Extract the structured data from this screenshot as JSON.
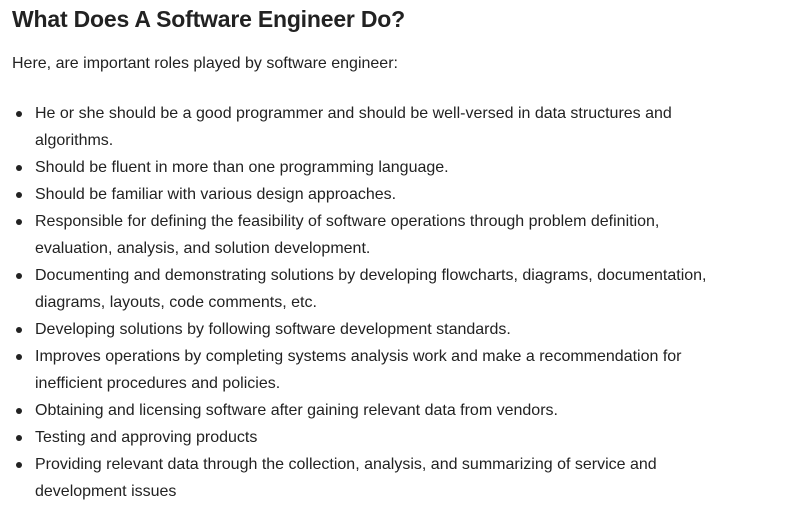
{
  "article": {
    "title": "What Does A Software Engineer Do?",
    "intro": "Here, are important roles played by software engineer:",
    "roles": [
      "He or she should be a good programmer and should be well-versed in data structures and algorithms.",
      "Should be fluent in more than one programming language.",
      "Should be familiar with various design approaches.",
      "Responsible for defining the feasibility of software operations through problem definition, evaluation, analysis, and solution development.",
      "Documenting and demonstrating solutions by developing flowcharts, diagrams, documentation, diagrams, layouts, code comments, etc.",
      "Developing solutions by following software development standards.",
      "Improves operations by completing systems analysis work and make a recommendation for inefficient procedures and policies.",
      "Obtaining and licensing software after gaining relevant data from vendors.",
      "Testing and approving products",
      "Providing relevant data through the collection, analysis, and summarizing of service and development issues"
    ]
  }
}
